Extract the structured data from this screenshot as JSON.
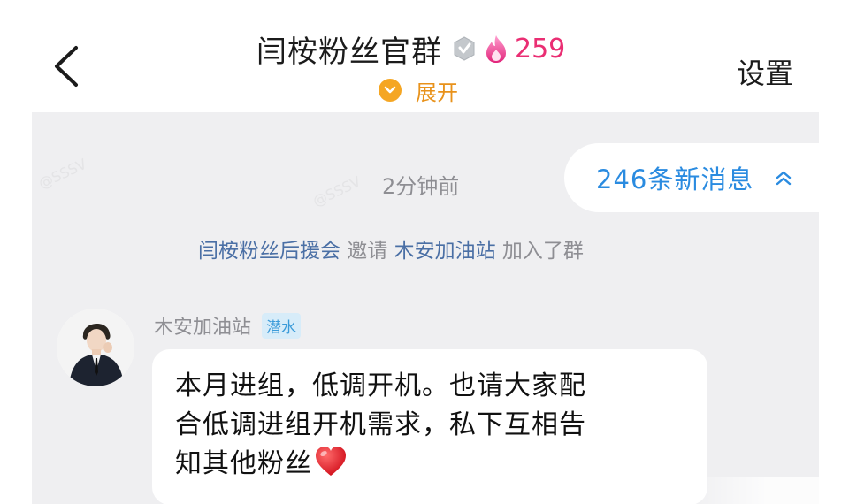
{
  "header": {
    "back_icon": "chevron-left-icon",
    "title": "闫桉粉丝官群",
    "verify_icon": "verified-badge-icon",
    "fire_icon": "flame-icon",
    "fire_count": "259",
    "expand_icon": "chevron-down-circle-icon",
    "expand_label": "展开",
    "settings_label": "设置"
  },
  "chat": {
    "timestamp": "2分钟前",
    "new_messages": {
      "label": "246条新消息",
      "icon": "double-chevron-up-icon"
    },
    "system_notice": {
      "inviter": "闫桉粉丝后援会",
      "verb": " 邀请 ",
      "invitee": "木安加油站",
      "suffix": " 加入了群"
    },
    "message": {
      "avatar_icon": "user-avatar",
      "sender": "木安加油站",
      "role_tag": "潜水",
      "lines": [
        "本月进组，低调开机。也请大家配",
        "合低调进组开机需求，私下互相告",
        "知其他粉丝"
      ],
      "emoji_icon": "red-heart-icon"
    }
  },
  "colors": {
    "chat_background": "#efeff1",
    "link_blue": "#2a8be0",
    "expand_orange": "#f5a623",
    "fire_pink": "#ea2e73",
    "tag_blue": "#3b9bd9"
  }
}
